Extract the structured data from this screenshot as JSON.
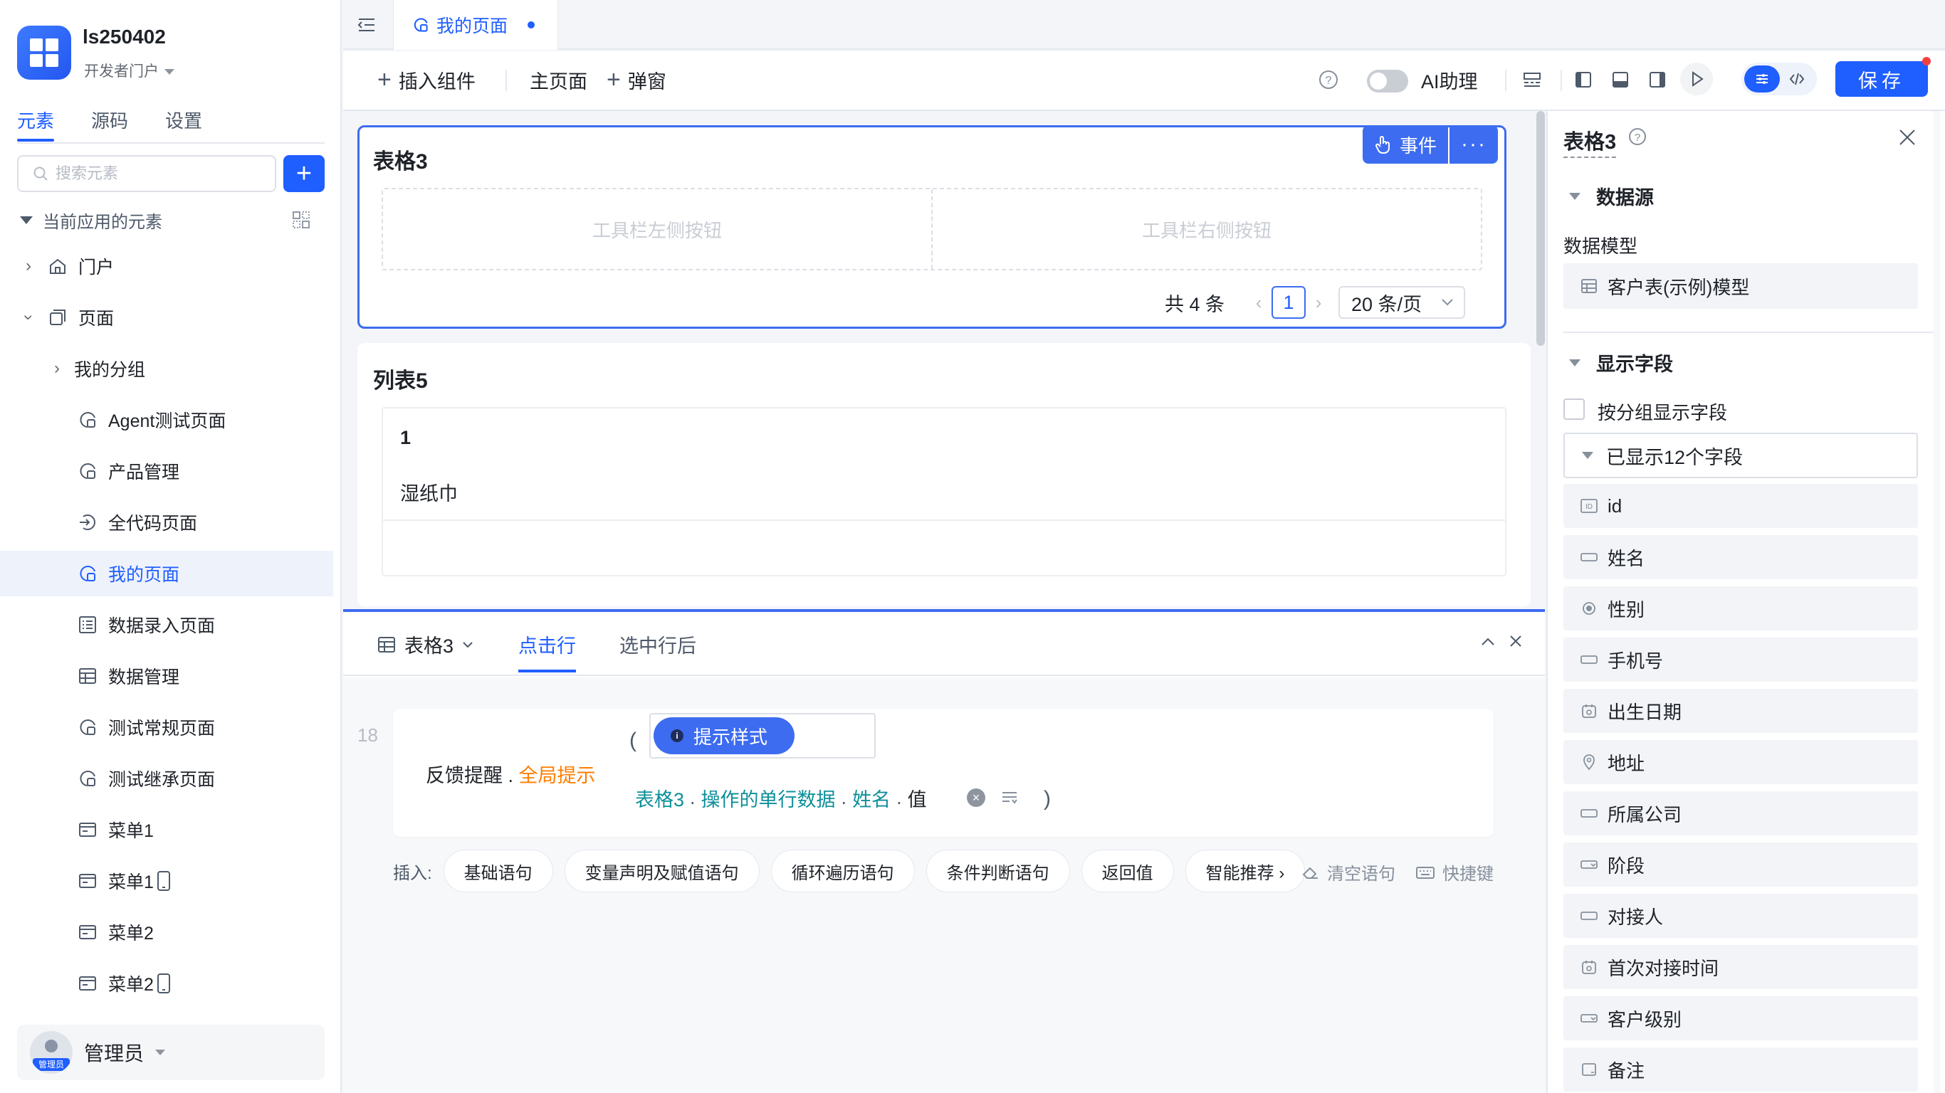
{
  "app": {
    "name": "ls250402",
    "portal": "开发者门户"
  },
  "sidebar": {
    "tabs": [
      "元素",
      "源码",
      "设置"
    ],
    "search_placeholder": "搜索元素",
    "add_label": "+",
    "tree_header": "当前应用的元素",
    "items": [
      {
        "label": "门户",
        "icon": "home-icon"
      },
      {
        "label": "页面",
        "icon": "pages-icon"
      },
      {
        "label": "我的分组",
        "icon": ""
      },
      {
        "label": "Agent测试页面",
        "icon": "page-icon"
      },
      {
        "label": "产品管理",
        "icon": "page-icon"
      },
      {
        "label": "全代码页面",
        "icon": "code-page-icon"
      },
      {
        "label": "我的页面",
        "icon": "page-icon"
      },
      {
        "label": "数据录入页面",
        "icon": "form-page-icon"
      },
      {
        "label": "数据管理",
        "icon": "table-page-icon"
      },
      {
        "label": "测试常规页面",
        "icon": "page-icon"
      },
      {
        "label": "测试继承页面",
        "icon": "page-icon"
      },
      {
        "label": "菜单1",
        "icon": "menu-icon"
      },
      {
        "label": "菜单1",
        "icon": "menu-icon"
      },
      {
        "label": "菜单2",
        "icon": "menu-icon"
      },
      {
        "label": "菜单2",
        "icon": "menu-icon"
      }
    ],
    "user": {
      "name": "管理员",
      "avatar_tag": "管理员"
    }
  },
  "tabs": {
    "active": "我的页面"
  },
  "toolbar": {
    "insert_component": "插入组件",
    "main_page": "主页面",
    "popup": "弹窗",
    "ai_assistant": "AI助理",
    "save": "保存"
  },
  "canvas": {
    "table_card": {
      "title": "表格3",
      "event_button": "事件",
      "more_button": "···",
      "left_slot": "工具栏左侧按钮",
      "right_slot": "工具栏右侧按钮",
      "pager_total": "共 4 条",
      "pager_page": "1",
      "pager_size": "20 条/页"
    },
    "list_card": {
      "title": "列表5",
      "row_id": "1",
      "row_name": "湿纸巾"
    }
  },
  "event_panel": {
    "component": "表格3",
    "tabs": [
      "点击行",
      "选中行后"
    ],
    "line_number": "18",
    "statement_prefix": "反馈提醒 .",
    "statement_method": "全局提示",
    "hint_label": "提示样式",
    "expr": [
      "表格3",
      "操作的单行数据",
      "姓名",
      "值"
    ],
    "insert_label": "插入:",
    "chips": [
      "基础语句",
      "变量声明及赋值语句",
      "循环遍历语句",
      "条件判断语句",
      "返回值",
      "智能推荐 ›"
    ],
    "clear_label": "清空语句",
    "shortcut_label": "快捷键"
  },
  "props": {
    "title": "表格3",
    "section_datasource": "数据源",
    "data_model_label": "数据模型",
    "data_model_value": "客户表(示例)模型",
    "section_fields": "显示字段",
    "group_checkbox_label": "按分组显示字段",
    "shown_count": "已显示12个字段",
    "fields": [
      {
        "label": "id",
        "icon": "id-icon"
      },
      {
        "label": "姓名",
        "icon": "text-field-icon"
      },
      {
        "label": "性别",
        "icon": "radio-icon"
      },
      {
        "label": "手机号",
        "icon": "text-field-icon"
      },
      {
        "label": "出生日期",
        "icon": "date-icon"
      },
      {
        "label": "地址",
        "icon": "location-icon"
      },
      {
        "label": "所属公司",
        "icon": "text-field-icon"
      },
      {
        "label": "阶段",
        "icon": "select-icon"
      },
      {
        "label": "对接人",
        "icon": "text-field-icon"
      },
      {
        "label": "首次对接时间",
        "icon": "date-icon"
      },
      {
        "label": "客户级别",
        "icon": "select-icon"
      },
      {
        "label": "备注",
        "icon": "textarea-icon"
      }
    ]
  },
  "colors": {
    "accent": "#1f5eff",
    "highlight": "#ff7d00",
    "teal": "#0e8f9a"
  }
}
